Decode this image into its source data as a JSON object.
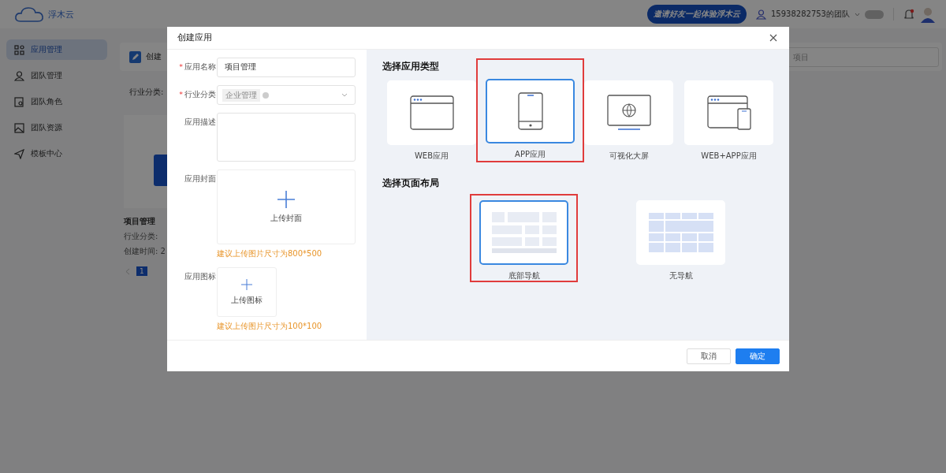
{
  "header": {
    "logo": "浮木云",
    "invite": "邀请好友一起体验浮木云",
    "team": "15938282753的团队"
  },
  "sidebar": {
    "items": [
      {
        "label": "应用管理",
        "selected": true
      },
      {
        "label": "团队管理",
        "selected": false
      },
      {
        "label": "团队角色",
        "selected": false
      },
      {
        "label": "团队资源",
        "selected": false
      },
      {
        "label": "模板中心",
        "selected": false
      }
    ]
  },
  "toolbar": {
    "create": "创建",
    "search_value": "项目"
  },
  "filter": {
    "label": "行业分类:"
  },
  "app_card": {
    "title": "项目管理",
    "industry": "行业分类:",
    "created": "创建时间: 2"
  },
  "pagination": {
    "pages": [
      {
        "label": "1",
        "selected": true
      }
    ]
  },
  "dialog": {
    "title": "创建应用",
    "form": [
      {
        "kind": "input",
        "label": "应用名称",
        "mark": "*",
        "value": "项目管理"
      },
      {
        "kind": "select",
        "label": "行业分类",
        "mark": "*",
        "tag": "企业管理"
      },
      {
        "kind": "textarea",
        "label": "应用描述"
      },
      {
        "kind": "cover",
        "label": "应用封面",
        "text": "上传封面",
        "hint": "建议上传图片尺寸为800*500"
      },
      {
        "kind": "icon",
        "label": "应用图标",
        "text": "上传图标",
        "hint": "建议上传图片尺寸为100*100"
      }
    ],
    "type_title": "选择应用类型",
    "types": [
      {
        "label": "WEB应用",
        "kind": "web",
        "selected": false,
        "marked": false
      },
      {
        "label": "APP应用",
        "kind": "app",
        "selected": true,
        "marked": true
      },
      {
        "label": "可视化大屏",
        "kind": "screen",
        "selected": false,
        "marked": false
      },
      {
        "label": "WEB+APP应用",
        "kind": "both",
        "selected": false,
        "marked": false
      }
    ],
    "layout_title": "选择页面布局",
    "layouts": [
      {
        "label": "底部导航",
        "kind": "bottom",
        "selected": true,
        "marked": true
      },
      {
        "label": "无导航",
        "kind": "none",
        "selected": false,
        "marked": false
      }
    ],
    "buttons": [
      {
        "label": "取消",
        "kind": "secondary"
      },
      {
        "label": "确定",
        "kind": "primary"
      }
    ]
  }
}
